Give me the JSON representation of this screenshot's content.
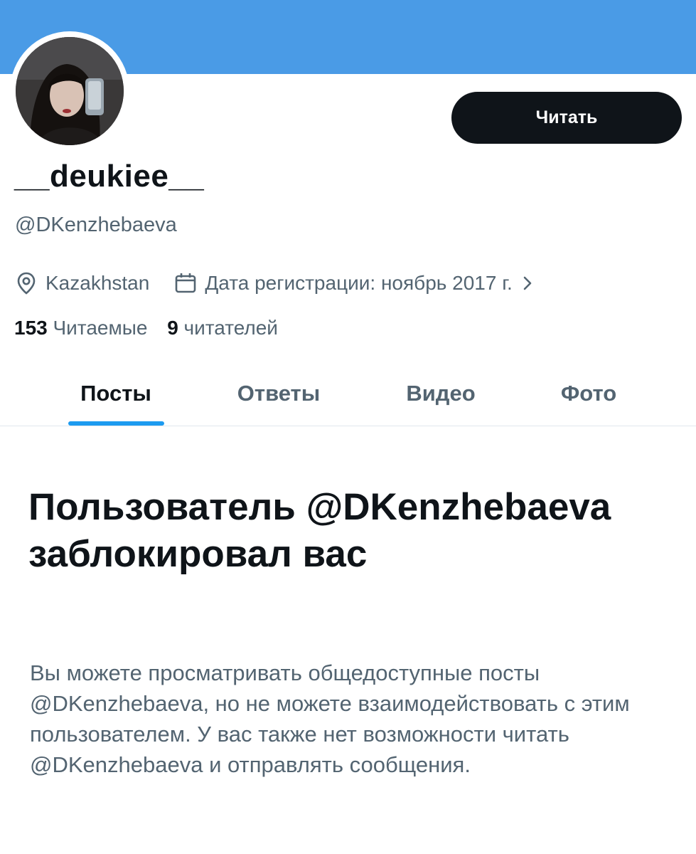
{
  "colors": {
    "banner": "#4a9be6",
    "accent": "#1d9bf0",
    "text_primary": "#0f1419",
    "text_secondary": "#536471",
    "button_bg": "#0f1419",
    "button_text": "#ffffff"
  },
  "profile": {
    "display_name": "__deukiee__",
    "handle": "@DKenzhebaeva",
    "follow_button_label": "Читать",
    "location": "Kazakhstan",
    "location_icon": "location-pin-icon",
    "joined": "Дата регистрации: ноябрь 2017 г.",
    "joined_icon": "calendar-icon",
    "following_count": "153",
    "following_label": "Читаемые",
    "followers_count": "9",
    "followers_label": "читателей"
  },
  "tabs": [
    {
      "label": "Посты",
      "active": true
    },
    {
      "label": "Ответы",
      "active": false
    },
    {
      "label": "Видео",
      "active": false
    },
    {
      "label": "Фото",
      "active": false
    }
  ],
  "blocked": {
    "title": "Пользователь @DKenzhebaeva заблокировал вас",
    "description": "Вы можете просматривать общедоступные посты @DKenzhebaeva, но не можете взаимодействовать с этим пользователем. У вас также нет возможности читать @DKenzhebaeva и отправлять сообщения."
  }
}
